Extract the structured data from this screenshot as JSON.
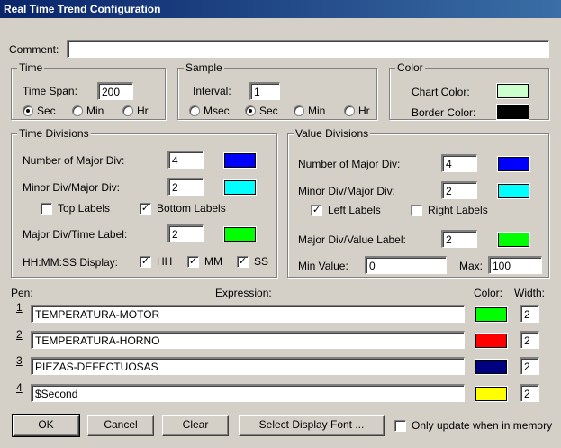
{
  "title": "Real Time Trend Configuration",
  "comment": {
    "label": "Comment:",
    "value": ""
  },
  "time": {
    "legend": "Time",
    "span_label": "Time Span:",
    "span_value": "200",
    "units": [
      "Sec",
      "Min",
      "Hr"
    ],
    "selected": "Sec"
  },
  "sample": {
    "legend": "Sample",
    "interval_label": "Interval:",
    "interval_value": "1",
    "units": [
      "Msec",
      "Sec",
      "Min",
      "Hr"
    ],
    "selected": "Sec"
  },
  "color": {
    "legend": "Color",
    "chart_label": "Chart Color:",
    "chart_color": "#ccffcc",
    "border_label": "Border Color:",
    "border_color": "#000000"
  },
  "time_divisions": {
    "legend": "Time Divisions",
    "major_label": "Number of Major Div:",
    "major_value": "4",
    "major_color": "#0000ff",
    "minor_label": "Minor Div/Major Div:",
    "minor_value": "2",
    "minor_color": "#00ffff",
    "top_labels": "Top Labels",
    "top_checked": false,
    "bottom_labels": "Bottom Labels",
    "bottom_checked": true,
    "time_label_label": "Major Div/Time Label:",
    "time_label_value": "2",
    "time_label_color": "#00ff00",
    "hms_label": "HH:MM:SS Display:",
    "hh": "HH",
    "mm": "MM",
    "ss": "SS"
  },
  "value_divisions": {
    "legend": "Value Divisions",
    "major_label": "Number of Major Div:",
    "major_value": "4",
    "major_color": "#0000ff",
    "minor_label": "Minor Div/Major Div:",
    "minor_value": "2",
    "minor_color": "#00ffff",
    "left_labels": "Left Labels",
    "left_checked": true,
    "right_labels": "Right Labels",
    "right_checked": false,
    "value_label_label": "Major Div/Value Label:",
    "value_label_value": "2",
    "value_label_color": "#00ff00",
    "min_label": "Min Value:",
    "min_value": "0",
    "max_label": "Max:",
    "max_value": "100"
  },
  "pens": {
    "pen_header": "Pen:",
    "expression_header": "Expression:",
    "color_header": "Color:",
    "width_header": "Width:",
    "rows": [
      {
        "num": "1",
        "expression": "TEMPERATURA-MOTOR",
        "color": "#00ff00",
        "width": "2"
      },
      {
        "num": "2",
        "expression": "TEMPERATURA-HORNO",
        "color": "#ff0000",
        "width": "2"
      },
      {
        "num": "3",
        "expression": "PIEZAS-DEFECTUOSAS",
        "color": "#000080",
        "width": "2"
      },
      {
        "num": "4",
        "expression": "$Second",
        "color": "#ffff00",
        "width": "2"
      }
    ]
  },
  "buttons": {
    "ok": "OK",
    "cancel": "Cancel",
    "clear": "Clear",
    "font": "Select Display Font ...",
    "memory": "Only update when in memory"
  }
}
